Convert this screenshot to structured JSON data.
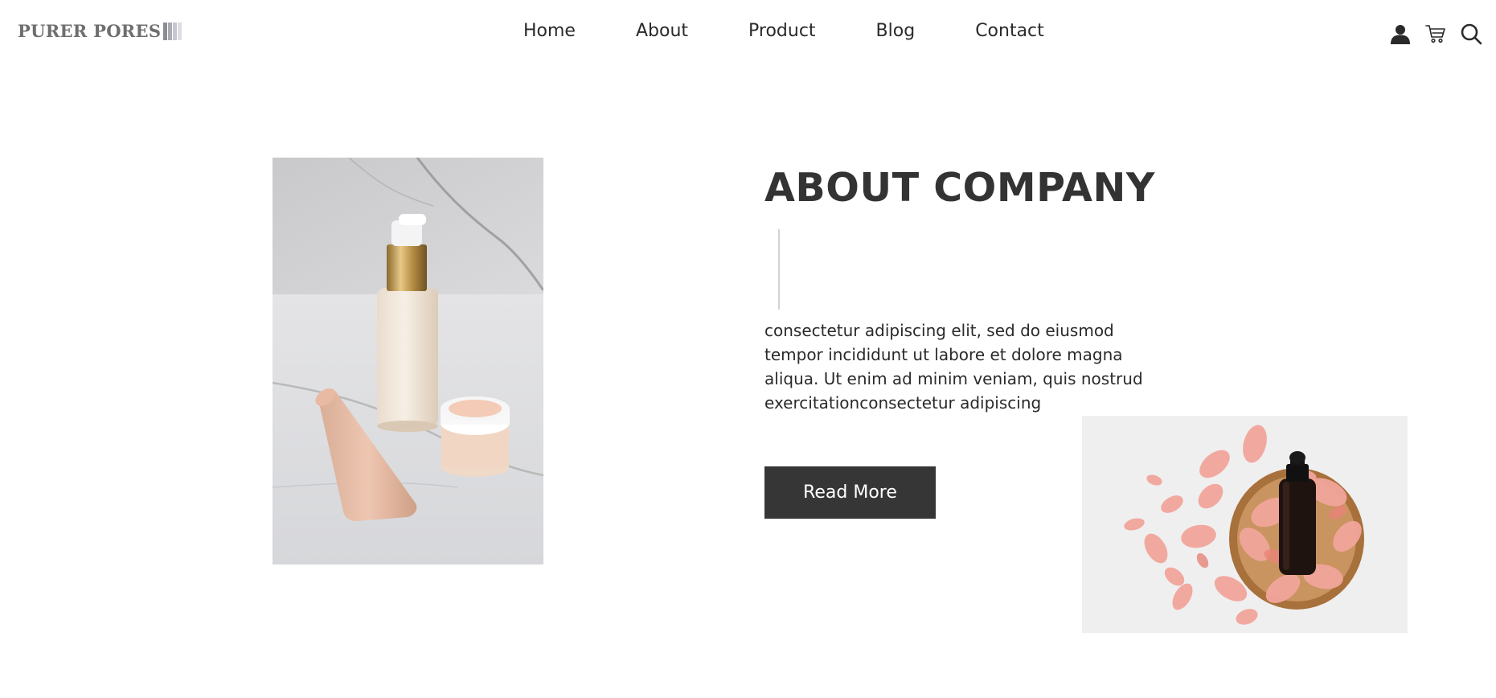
{
  "brand": {
    "name": "PURER PORES"
  },
  "nav": {
    "items": [
      {
        "label": "Home"
      },
      {
        "label": "About"
      },
      {
        "label": "Product"
      },
      {
        "label": "Blog"
      },
      {
        "label": "Contact"
      }
    ]
  },
  "header_icons": [
    "user-icon",
    "cart-icon",
    "search-icon"
  ],
  "about": {
    "title": "ABOUT COMPANY",
    "text": "consectetur adipiscing elit, sed do eiusmod tempor incididunt ut labore et dolore magna aliqua. Ut enim ad minim veniam, quis nostrud exercitationconsectetur adipiscing",
    "button_label": "Read More"
  },
  "colors": {
    "text_dark": "#333333",
    "button_bg": "#363636",
    "button_text": "#ffffff",
    "divider": "#d2d2d2"
  }
}
